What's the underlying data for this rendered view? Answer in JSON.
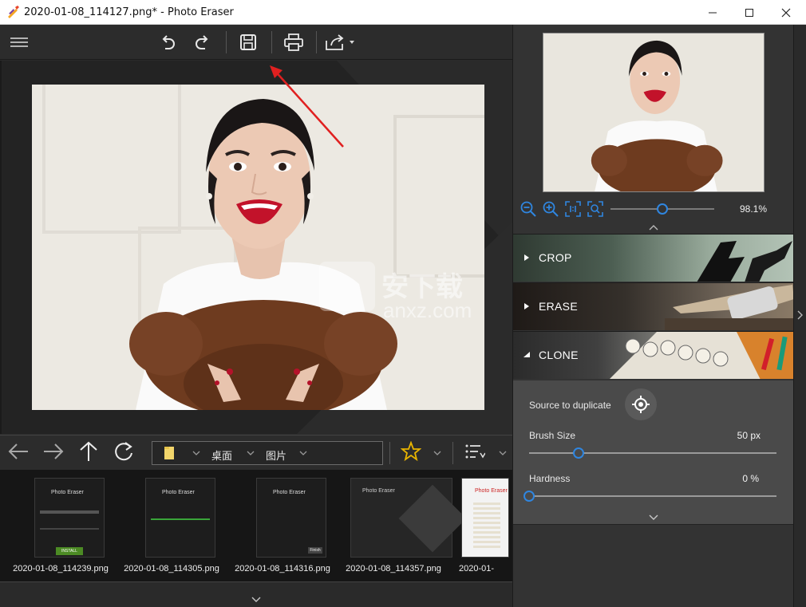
{
  "window": {
    "title": "2020-01-08_114127.png* - Photo Eraser",
    "minimize_symbol": "—",
    "maximize_symbol": "☐",
    "close_symbol": "✕"
  },
  "toolbar": {
    "icons": [
      "menu-icon",
      "undo-icon",
      "redo-icon",
      "save-icon",
      "print-icon",
      "share-icon"
    ]
  },
  "watermark": {
    "text_cn": "安下载",
    "text_en": "anxz.com"
  },
  "nav": {
    "crumbs": [
      "桌面",
      "图片"
    ],
    "icons": [
      "back-arrow-icon",
      "forward-arrow-icon",
      "up-arrow-icon",
      "refresh-icon",
      "folder-icon",
      "star-icon",
      "sort-list-icon"
    ]
  },
  "thumbnails": [
    {
      "caption": "2020-01-08_114239.png",
      "header": "Photo Eraser",
      "button": "INSTALL"
    },
    {
      "caption": "2020-01-08_114305.png",
      "header": "Photo Eraser",
      "button": ""
    },
    {
      "caption": "2020-01-08_114316.png",
      "header": "Photo Eraser",
      "button": "Finish"
    },
    {
      "caption": "2020-01-08_114357.png",
      "header": "Photo Eraser",
      "button": ""
    },
    {
      "caption": "2020-01-",
      "header": "Photo Eraser",
      "button": ""
    }
  ],
  "preview": {
    "zoom_label": "98.1%",
    "zoom_level_fraction": 0.5,
    "icons": [
      "zoom-out-icon",
      "zoom-in-icon",
      "actual-size-icon",
      "fit-icon"
    ]
  },
  "sections": [
    {
      "label": "CROP",
      "expanded": false
    },
    {
      "label": "ERASE",
      "expanded": false
    },
    {
      "label": "CLONE",
      "expanded": true
    }
  ],
  "clone": {
    "source_label": "Source to duplicate",
    "brush_label": "Brush Size",
    "brush_value": "50 px",
    "brush_fraction": 0.2,
    "hardness_label": "Hardness",
    "hardness_value": "0 %",
    "hardness_fraction": 0.0
  },
  "colors": {
    "accent": "#2f86e0",
    "star": "#e8b400",
    "lips": "#c2122a"
  }
}
